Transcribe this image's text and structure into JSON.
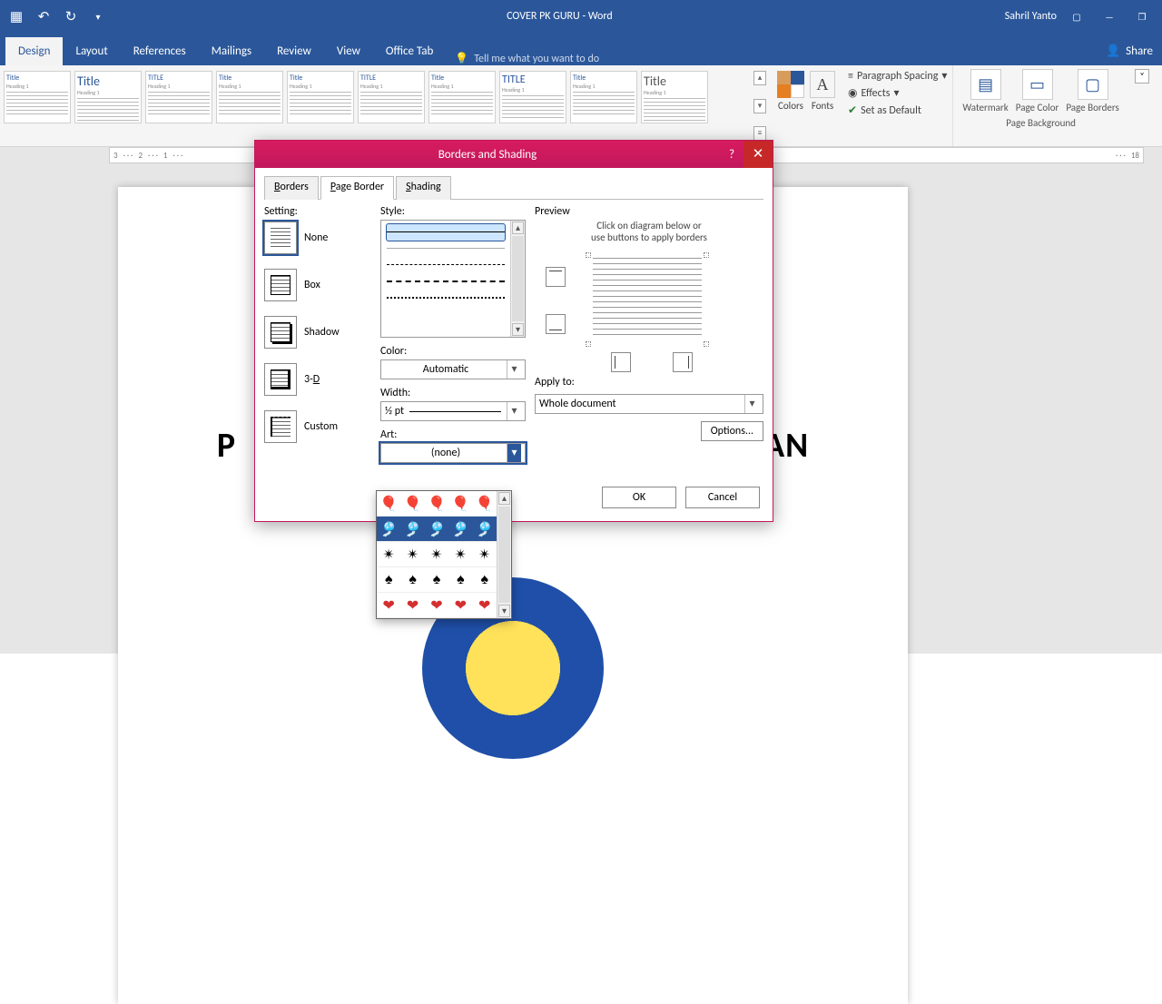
{
  "title_bar": {
    "doc_title": "COVER PK GURU  -  Word",
    "user_name": "Sahril Yanto"
  },
  "ribbon_tabs": {
    "design": "Design",
    "layout": "Layout",
    "references": "References",
    "mailings": "Mailings",
    "review": "Review",
    "view": "View",
    "office_tab": "Office Tab",
    "tell_me": "Tell me what you want to do",
    "share": "Share"
  },
  "design_ribbon": {
    "gallery_item_title": "Title",
    "gallery_item_title_caps": "TITLE",
    "gallery_item_heading": "Heading 1",
    "colors": "Colors",
    "fonts": "Fonts",
    "paragraph_spacing": "Paragraph Spacing",
    "effects": "Effects",
    "set_as_default": "Set as Default",
    "watermark": "Watermark",
    "page_color": "Page Color",
    "page_borders": "Page Borders",
    "page_background_group": "Page Background"
  },
  "document": {
    "headline_left": "P",
    "headline_right": "AN"
  },
  "ruler": {
    "marks": [
      "3",
      "2",
      "1",
      "",
      "1",
      "",
      "18"
    ]
  },
  "dialog": {
    "title": "Borders and Shading",
    "tabs": {
      "borders": "Borders",
      "page_border": "Page Border",
      "shading": "Shading"
    },
    "setting_label": "Setting:",
    "settings": {
      "none": "None",
      "box": "Box",
      "shadow": "Shadow",
      "three_d": "3-D",
      "custom": "Custom"
    },
    "style_label": "Style:",
    "color_label": "Color:",
    "color_value": "Automatic",
    "width_label": "Width:",
    "width_value": "½ pt",
    "art_label": "Art:",
    "art_value": "(none)",
    "preview_label": "Preview",
    "preview_hint_1": "Click on diagram below or",
    "preview_hint_2": "use buttons to apply borders",
    "apply_to_label": "Apply to:",
    "apply_to_value": "Whole document",
    "options": "Options...",
    "ok": "OK",
    "cancel": "Cancel"
  },
  "art_dropdown": {
    "rows": [
      [
        "🎈",
        "🎈",
        "🎈",
        "🎈",
        "🎈"
      ],
      [
        "🎐",
        "🎐",
        "🎐",
        "🎐",
        "🎐"
      ],
      [
        "✴",
        "✴",
        "✴",
        "✴",
        "✴"
      ],
      [
        "♠",
        "♠",
        "♠",
        "♠",
        "♠"
      ],
      [
        "❤",
        "❤",
        "❤",
        "❤",
        "❤"
      ]
    ]
  }
}
